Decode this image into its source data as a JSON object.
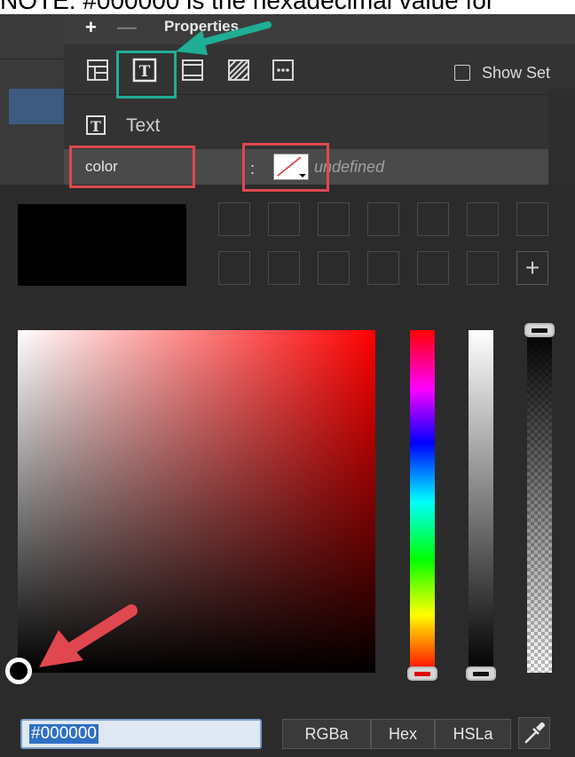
{
  "caption": "NOTE: #000000 is the hexadecimal value for",
  "properties": {
    "add_label": "+",
    "remove_label": "—",
    "title": "Properties",
    "toolbar": [
      "layout",
      "text",
      "box",
      "background",
      "more"
    ],
    "show_set_label": "Show Set",
    "section_label": "Text",
    "row": {
      "name": "color",
      "separator": ":",
      "value": "undefined"
    }
  },
  "picker": {
    "current_color": "#000000",
    "hue_color": "#ff0000",
    "hex_value": "#000000",
    "modes": [
      "RGBa",
      "Hex",
      "HSLa"
    ]
  },
  "annotation_colors": {
    "red": "#e0474f",
    "green": "#1fae95"
  }
}
